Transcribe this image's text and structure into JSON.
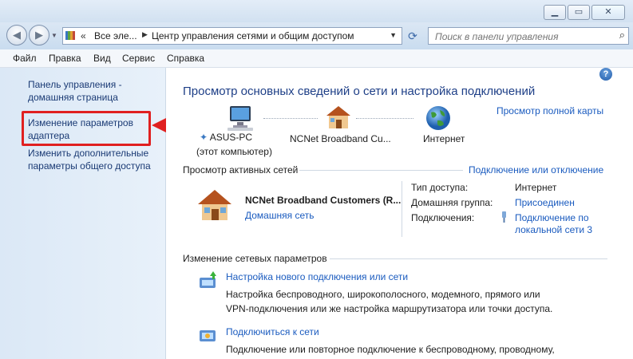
{
  "nav": {
    "address_chevron": "«",
    "breadcrumb_1": "Все эле...",
    "breadcrumb_sep": "▶",
    "breadcrumb_2": "Центр управления сетями и общим доступом",
    "search_placeholder": "Поиск в панели управления"
  },
  "menu": [
    "Файл",
    "Правка",
    "Вид",
    "Сервис",
    "Справка"
  ],
  "left_pane": {
    "home_link": [
      "Панель управления -",
      "домашняя страница"
    ],
    "adapter_link": [
      "Изменение параметров",
      "адаптера"
    ],
    "sharing_link": [
      "Изменить дополнительные",
      "параметры общего доступа"
    ],
    "highlight_color": "#e02020"
  },
  "main": {
    "help": "?",
    "heading": "Просмотр основных сведений о сети и настройка подключений",
    "full_map_link": "Просмотр полной карты",
    "map": {
      "computer_name": "ASUS-PC",
      "computer_sub": "(этот компьютер)",
      "network_name": "NCNet Broadband Cu...",
      "internet": "Интернет"
    },
    "active_networks_label": "Просмотр активных сетей",
    "connect_disconnect_link": "Подключение или отключение",
    "network": {
      "name": "NCNet Broadband Customers (R...",
      "type_link": "Домашняя сеть",
      "access_type_label": "Тип доступа:",
      "access_type_value": "Интернет",
      "homegroup_label": "Домашняя группа:",
      "homegroup_value": "Присоединен",
      "connections_label": "Подключения:",
      "connection_link": [
        "Подключение по",
        "локальной сети 3"
      ]
    },
    "change_settings_label": "Изменение сетевых параметров",
    "tasks": [
      {
        "title": "Настройка нового подключения или сети",
        "description": [
          "Настройка беспроводного, широкополосного, модемного, прямого или",
          "VPN-подключения или же настройка маршрутизатора или точки доступа."
        ]
      },
      {
        "title": "Подключиться к сети",
        "description": [
          "Подключение или повторное подключение к беспроводному, проводному,"
        ]
      }
    ]
  },
  "colors": {
    "link": "#1a5bbf",
    "heading": "#1e3f87",
    "left_link": "#1a3a74",
    "red": "#e02020"
  }
}
